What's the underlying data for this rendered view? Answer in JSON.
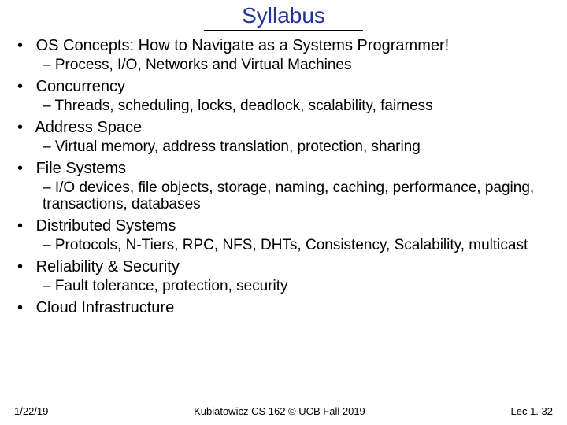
{
  "title": "Syllabus",
  "topics": [
    {
      "label": "OS Concepts: How to Navigate as a Systems Programmer!",
      "sub": "Process, I/O, Networks and Virtual Machines"
    },
    {
      "label": "Concurrency",
      "sub": "Threads, scheduling, locks, deadlock, scalability, fairness"
    },
    {
      "label": "Address Space",
      "sub": "Virtual memory, address translation, protection, sharing"
    },
    {
      "label": "File Systems",
      "sub": "I/O devices, file objects, storage, naming, caching, performance, paging, transactions, databases"
    },
    {
      "label": "Distributed Systems",
      "sub": "Protocols, N-Tiers, RPC, NFS, DHTs, Consistency, Scalability, multicast"
    },
    {
      "label": "Reliability & Security",
      "sub": "Fault tolerance, protection, security"
    },
    {
      "label": "Cloud Infrastructure",
      "sub": null
    }
  ],
  "footer": {
    "date": "1/22/19",
    "center": "Kubiatowicz CS 162 © UCB Fall 2019",
    "right": "Lec 1. 32"
  }
}
